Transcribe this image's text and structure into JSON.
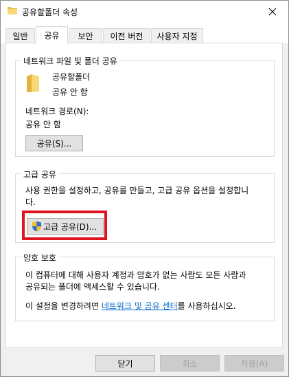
{
  "window": {
    "title": "공유할폴더 속성",
    "title_icon": "folder-icon",
    "close_icon": "close-icon"
  },
  "tabs": [
    {
      "label": "일반",
      "active": false
    },
    {
      "label": "공유",
      "active": true
    },
    {
      "label": "보안",
      "active": false
    },
    {
      "label": "이전 버전",
      "active": false
    },
    {
      "label": "사용자 지정",
      "active": false
    }
  ],
  "network_sharing": {
    "group_title": "네트워크 파일 및 폴더 공유",
    "folder_name": "공유할폴더",
    "folder_status": "공유 안 함",
    "path_label": "네트워크 경로(N):",
    "path_value": "공유 안 함",
    "share_button": "공유(S)..."
  },
  "advanced_sharing": {
    "group_title": "고급 공유",
    "description": "사용 권한을 설정하고, 공유를 만들고, 고급 공유 옵션을 설정합니다.",
    "description_line1": "사용 권한을 설정하고, 공유를 만들고, 고급 공유 옵션을 설정합니",
    "description_line2": "다.",
    "button": "고급 공유(D)...",
    "button_icon": "uac-shield-icon",
    "highlight_color": "#e0141e"
  },
  "password_protection": {
    "group_title": "암호 보호",
    "line1": "이 컴퓨터에 대해 사용자 계정과 암호가 없는 사람도 모든 사람과",
    "line2": "공유되는 폴더에 액세스할 수 있습니다.",
    "line3_prefix": "이 설정을 변경하려면 ",
    "link_text": "네트워크 및 공유 센터",
    "line3_suffix": "를 사용하십시오."
  },
  "footer": {
    "close_button": "닫기",
    "cancel_button": "취소",
    "apply_button": "적용(A)"
  },
  "colors": {
    "link": "#0066cc",
    "folder": "#f8d775",
    "dialog_bg": "#f0f0f0"
  }
}
